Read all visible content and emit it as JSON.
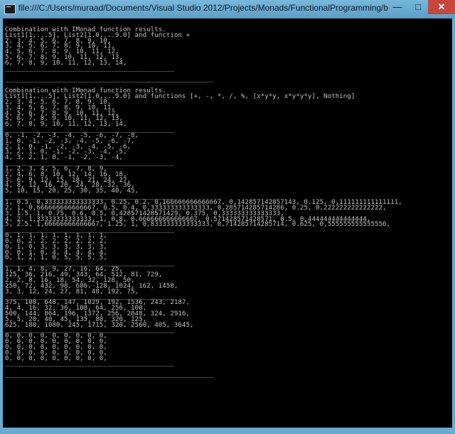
{
  "window": {
    "title": "file:///C:/Users/muraad/Documents/Visual Studio 2012/Projects/Monads/FunctionalProgramming/bin/Debug/Functio...",
    "minimize_glyph": "—",
    "maximize_glyph": "□",
    "close_glyph": "✕"
  },
  "console": {
    "lines": [
      "",
      "Combination with IMonad function results.",
      "List1[1,...5], List2[1.0,...9.0] and function +",
      "2, 3, 4, 5, 6, 7, 8, 9, 10,",
      "3, 4, 5, 6, 7, 8, 9, 10, 11,",
      "4, 5, 6, 7, 8, 9, 10, 11, 12,",
      "5, 6, 7, 8, 9, 10, 11, 12, 13,",
      "6, 7, 8, 9, 10, 11, 12, 13, 14,",
      "___________________________________________",
      "",
      "_____________________________________________________",
      "",
      "Combination with IMonad function results.",
      "List1[1,...5], List2[1.0,...9.0] and functions [+, -, *, /, %, [x*y*y, x*y*y*y], Nothing]",
      "2, 3, 4, 5, 6, 7, 8, 9, 10,",
      "3, 4, 5, 6, 7, 8, 9, 10, 11,",
      "4, 5, 6, 7, 8, 9, 10, 11, 12,",
      "5, 6, 7, 8, 9, 10, 11, 12, 13,",
      "6, 7, 8, 9, 10, 11, 12, 13, 14,",
      "___________________________________________",
      "0, -1, -2, -3, -4, -5, -6, -7, -8,",
      "1, 0, -1, -2, -3, -4, -5, -6, -7,",
      "2, 1, 0, -1, -2, -3, -4, -5, -6,",
      "3, 2, 1, 0, -1, -2, -3, -4, -5,",
      "4, 3, 2, 1, 0, -1, -2, -3, -4,",
      "___________________________________________",
      "1, 2, 3, 4, 5, 6, 7, 8, 9,",
      "2, 4, 6, 8, 10, 12, 14, 16, 18,",
      "3, 6, 9, 12, 15, 18, 21, 24, 27,",
      "4, 8, 12, 16, 20, 24, 28, 32, 36,",
      "5, 10, 15, 20, 25, 30, 35, 40, 45,",
      "___________________________________________",
      "1, 0.5, 0,333333333333333, 0.25, 0.2, 0,166666666666667, 0,142857142857143, 0.125, 0,111111111111111,",
      "2, 1, 0,666666666666667, 0.5, 0.4, 0,333333333333333, 0,285714285714286, 0.25, 0,222222222222222,",
      "3, 1.5, 1, 0.75, 0.6, 0.5, 0,428571428571429, 0.375, 0,333333333333333,",
      "4, 2, 1,33333333333333, 1, 0.8, 0,666666666666667, 0,571428571428571, 0.5, 0,444444444444444,",
      "5, 2.5, 1,66666666666667, 1.25, 1, 0,833333333333333, 0,714285714285714, 0.625, 0,555555555555556,",
      "___________________________________________",
      "0, 1, 1, 1, 1, 1, 1, 1, 1,",
      "0, 0, 2, 2, 2, 2, 2, 2, 2,",
      "0, 1, 0, 3, 3, 3, 3, 3, 3,",
      "0, 0, 1, 0, 4, 4, 4, 4, 4,",
      "0, 1, 2, 1, 0, 5, 5, 5, 5,",
      "___________________________________________",
      "1, 1, 4, 8, 9, 27, 16, 64, 25,",
      "125, 36, 216, 49, 343, 64, 512, 81, 729,",
      "2, 2, 8, 16, 18, 54, 32, 128, 50,",
      "250, 72, 432, 98, 686, 128, 1024, 162, 1458,",
      "3, 3, 12, 24, 27, 81, 48, 192, 75,",
      "___________________________________________",
      "375, 108, 648, 147, 1029, 192, 1536, 243, 2187,",
      "4, 4, 16, 32, 36, 108, 64, 256, 100,",
      "500, 144, 864, 196, 1372, 256, 2048, 324, 2916,",
      "5, 5, 20, 40, 45, 135, 80, 320, 125,",
      "625, 180, 1080, 245, 1715, 320, 2560, 405, 3645,",
      "___________________________________________",
      "0, 0, 0, 0, 0, 0, 0, 0, 0,",
      "0, 0, 0, 0, 0, 0, 0, 0, 0,",
      "0, 0, 0, 0, 0, 0, 0, 0, 0,",
      "0, 0, 0, 0, 0, 0, 0, 0, 0,",
      "0, 0, 0, 0, 0, 0, 0, 0, 0,",
      "___________________________________________",
      "",
      "_____________________________________________________"
    ]
  }
}
